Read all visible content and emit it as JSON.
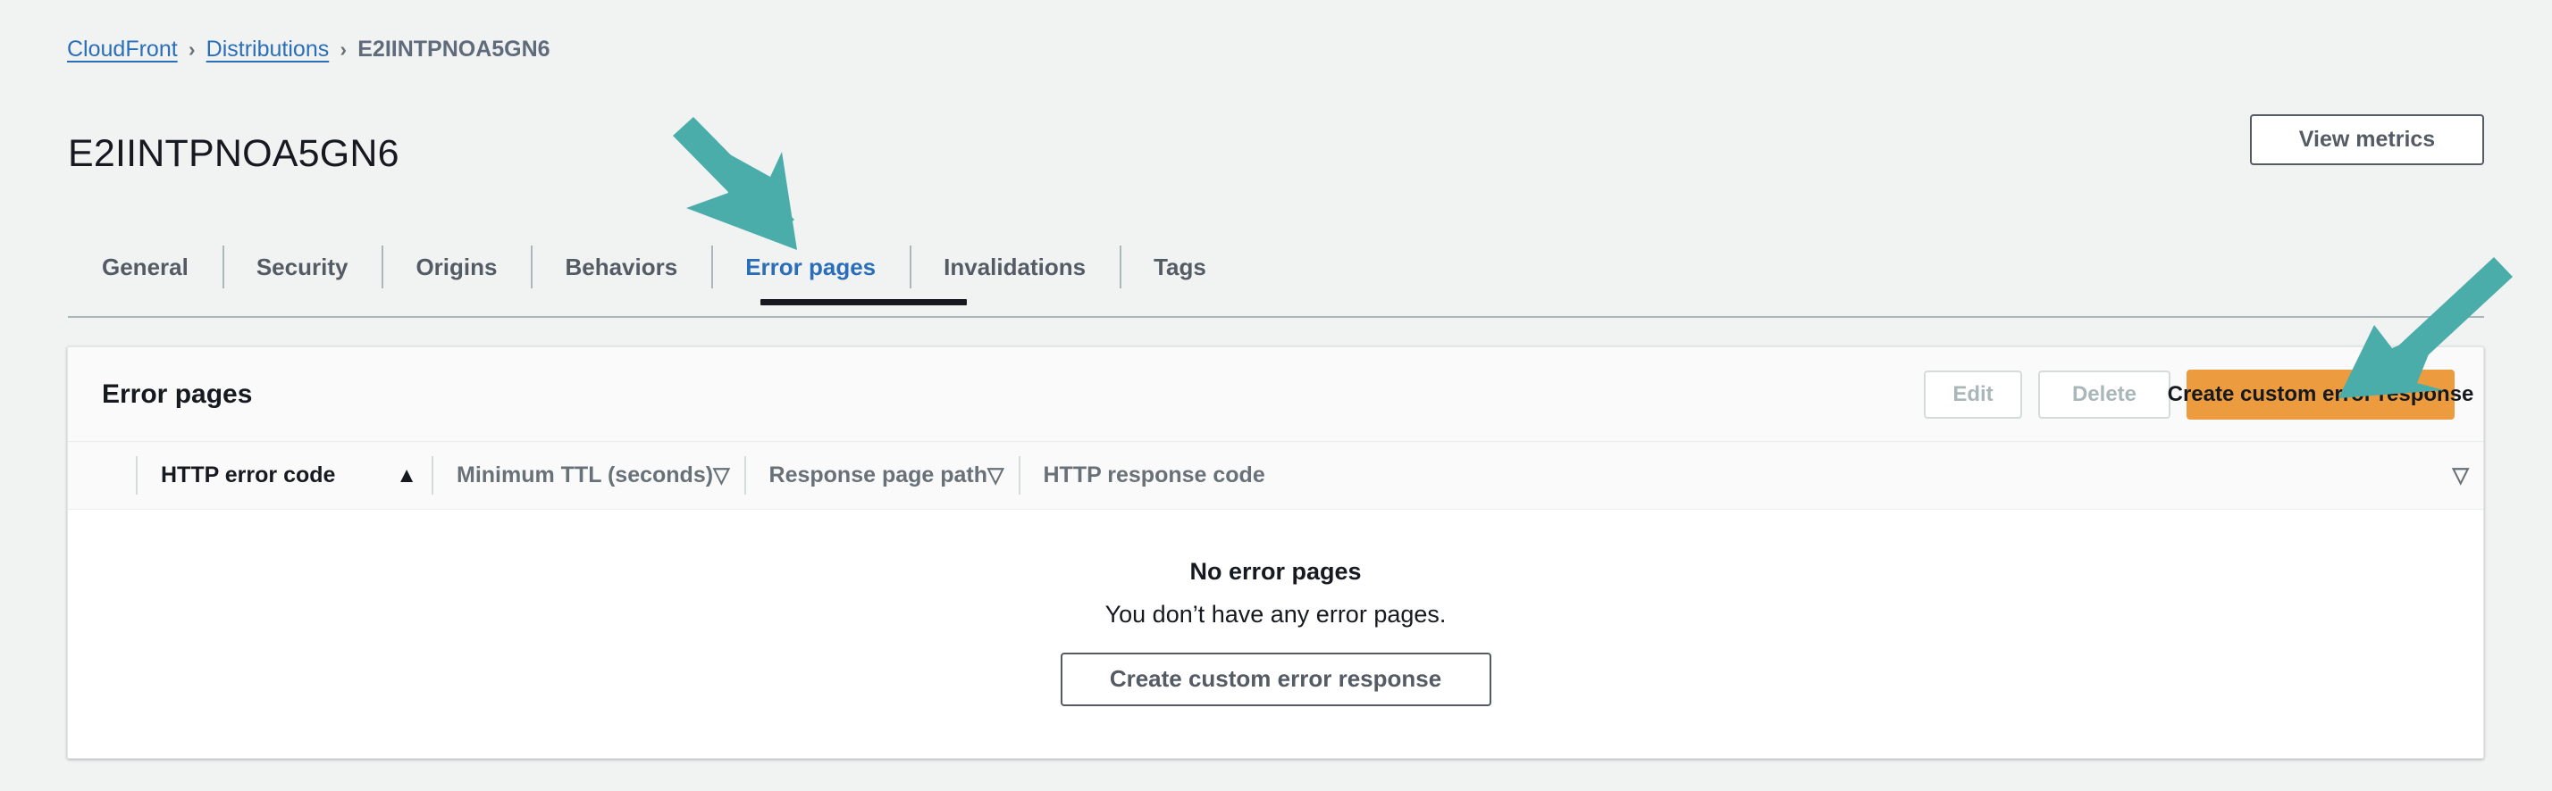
{
  "breadcrumb": {
    "items": [
      {
        "label": "CloudFront",
        "type": "link"
      },
      {
        "label": "Distributions",
        "type": "link"
      },
      {
        "label": "E2IINTPNOA5GN6",
        "type": "current"
      }
    ],
    "separator": "›"
  },
  "header": {
    "title": "E2IINTPNOA5GN6",
    "view_metrics_label": "View metrics"
  },
  "tabs": [
    {
      "label": "General",
      "active": false
    },
    {
      "label": "Security",
      "active": false
    },
    {
      "label": "Origins",
      "active": false
    },
    {
      "label": "Behaviors",
      "active": false
    },
    {
      "label": "Error pages",
      "active": true
    },
    {
      "label": "Invalidations",
      "active": false
    },
    {
      "label": "Tags",
      "active": false
    }
  ],
  "card": {
    "title": "Error pages",
    "actions": {
      "edit_label": "Edit",
      "delete_label": "Delete",
      "create_label": "Create custom error response"
    }
  },
  "table": {
    "columns": [
      {
        "label": "HTTP error code",
        "sort_icon": "▲",
        "sorted": true
      },
      {
        "label": "Minimum TTL (seconds)",
        "sort_icon": "▽",
        "sorted": false
      },
      {
        "label": "Response page path",
        "sort_icon": "▽",
        "sorted": false
      },
      {
        "label": "HTTP response code",
        "sort_icon": "▽",
        "sorted": false
      }
    ],
    "rows": []
  },
  "empty_state": {
    "title": "No error pages",
    "description": "You don’t have any error pages.",
    "button_label": "Create custom error response"
  },
  "colors": {
    "page_background": "#f1f3f3",
    "link": "#2a6eba",
    "primary_button": "#ec9c3f",
    "text_dark": "#16191f",
    "text_muted": "#687078",
    "annotation_arrow": "#4aadaa",
    "active_tab_underline": "#16191f"
  },
  "annotations": [
    {
      "name": "arrow-to-error-pages-tab",
      "target": "Error pages tab"
    },
    {
      "name": "arrow-to-create-custom-error-response-button",
      "target": "Create custom error response button"
    }
  ]
}
